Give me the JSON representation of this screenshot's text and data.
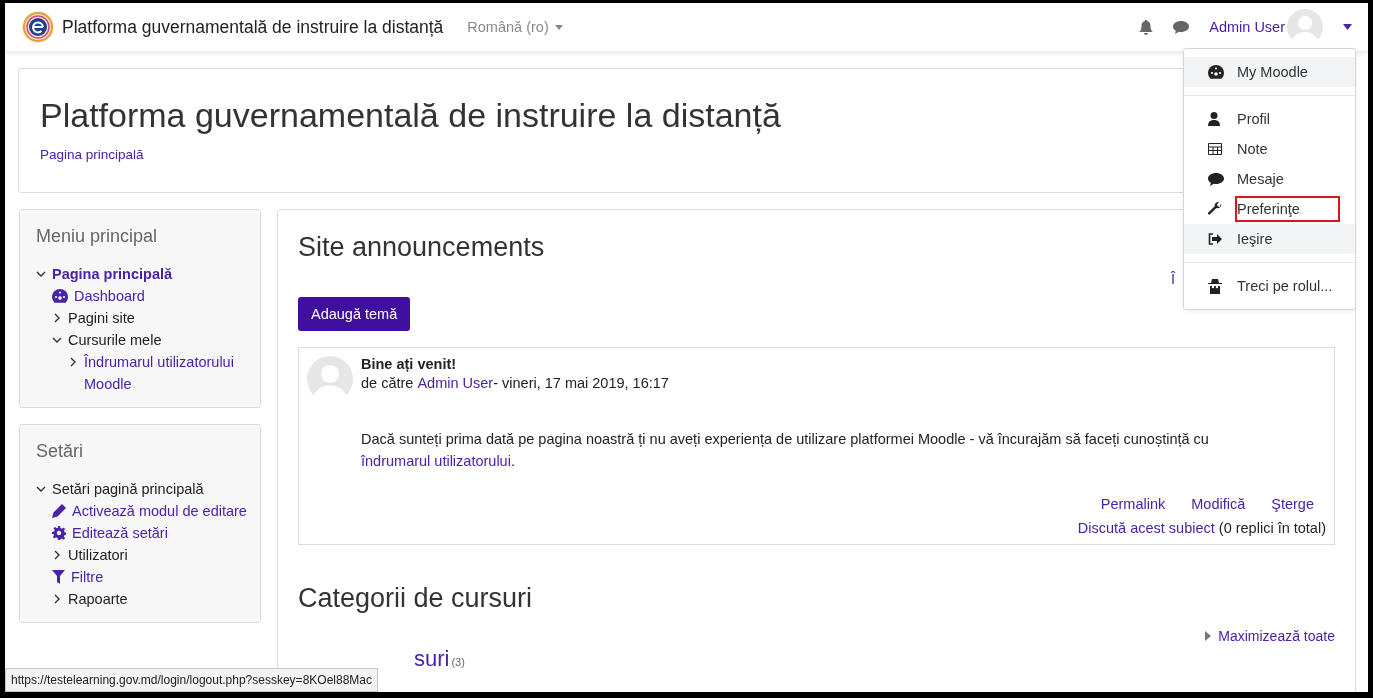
{
  "navbar": {
    "site_name": "Platforma guvernamentală de instruire la distanță",
    "language": "Română (ro)",
    "user_name": "Admin User"
  },
  "user_menu": [
    {
      "label": "My Moodle",
      "kind": "dashboard",
      "highlighted": true,
      "outlined": false,
      "divider_after": true
    },
    {
      "label": "Profil",
      "kind": "user",
      "highlighted": false,
      "outlined": false,
      "divider_after": false
    },
    {
      "label": "Note",
      "kind": "grades",
      "highlighted": false,
      "outlined": false,
      "divider_after": false
    },
    {
      "label": "Mesaje",
      "kind": "chat",
      "highlighted": false,
      "outlined": false,
      "divider_after": false
    },
    {
      "label": "Preferinţe",
      "kind": "wrench",
      "highlighted": false,
      "outlined": true,
      "divider_after": false
    },
    {
      "label": "Ieşire",
      "kind": "logout",
      "highlighted": true,
      "outlined": false,
      "divider_after": true
    },
    {
      "label": "Treci pe rolul...",
      "kind": "role",
      "highlighted": false,
      "outlined": false,
      "divider_after": false
    }
  ],
  "page_header": {
    "title": "Platforma guvernamentală de instruire la distanță",
    "breadcrumb": "Pagina principală"
  },
  "blocks": [
    {
      "title": "Meniu principal",
      "items": [
        {
          "label": "Pagina principală",
          "kind": "branch",
          "expanded": true,
          "link": true,
          "current": true,
          "children": [
            {
              "label": "Dashboard",
              "kind": "dashboard",
              "link": true,
              "current": false
            },
            {
              "label": "Pagini site",
              "kind": "branch",
              "expanded": false,
              "link": false,
              "current": false
            },
            {
              "label": "Cursurile mele",
              "kind": "branch",
              "expanded": true,
              "link": false,
              "current": false,
              "children": [
                {
                  "label": "Îndrumarul utilizatorului Moodle",
                  "kind": "branch",
                  "expanded": false,
                  "link": true,
                  "current": false
                }
              ]
            }
          ]
        }
      ]
    },
    {
      "title": "Setări",
      "items": [
        {
          "label": "Setări pagină principală",
          "kind": "branch",
          "expanded": true,
          "link": false,
          "current": false,
          "children": [
            {
              "label": "Activează modul de editare",
              "kind": "edit",
              "link": true,
              "current": false
            },
            {
              "label": "Editează setări",
              "kind": "settings",
              "link": true,
              "current": false
            },
            {
              "label": "Utilizatori",
              "kind": "branch",
              "expanded": false,
              "link": false,
              "current": false
            },
            {
              "label": "Filtre",
              "kind": "filter",
              "link": true,
              "current": false
            },
            {
              "label": "Rapoarte",
              "kind": "branch",
              "expanded": false,
              "link": false,
              "current": false
            }
          ]
        }
      ]
    }
  ],
  "announcements": {
    "title": "Site announcements",
    "side_link": "Î",
    "button": "Adaugă temă",
    "post": {
      "subject": "Bine ați venit!",
      "by_prefix": "de către",
      "author": "Admin User",
      "date": "- vineri, 17 mai 2019, 16:17",
      "body": "Dacă sunteți prima dată pe pagina noastră ți nu aveți experiența de utilizare platformei Moodle - vă încurajăm să faceți cunoștință cu",
      "body_link": "îndrumarul utilizatorului",
      "body_end": ".",
      "actions": [
        "Permalink",
        "Modifică",
        "Şterge"
      ],
      "discuss": "Discută acest subiect",
      "replies": "(0 replici în total)"
    }
  },
  "categories": {
    "title": "Categorii de cursuri",
    "expand_all": "Maximizează toate",
    "category": "suri",
    "count": "(3)"
  },
  "status_url": "https://testelearning.gov.md/login/logout.php?sesskey=8KOel88Mac"
}
